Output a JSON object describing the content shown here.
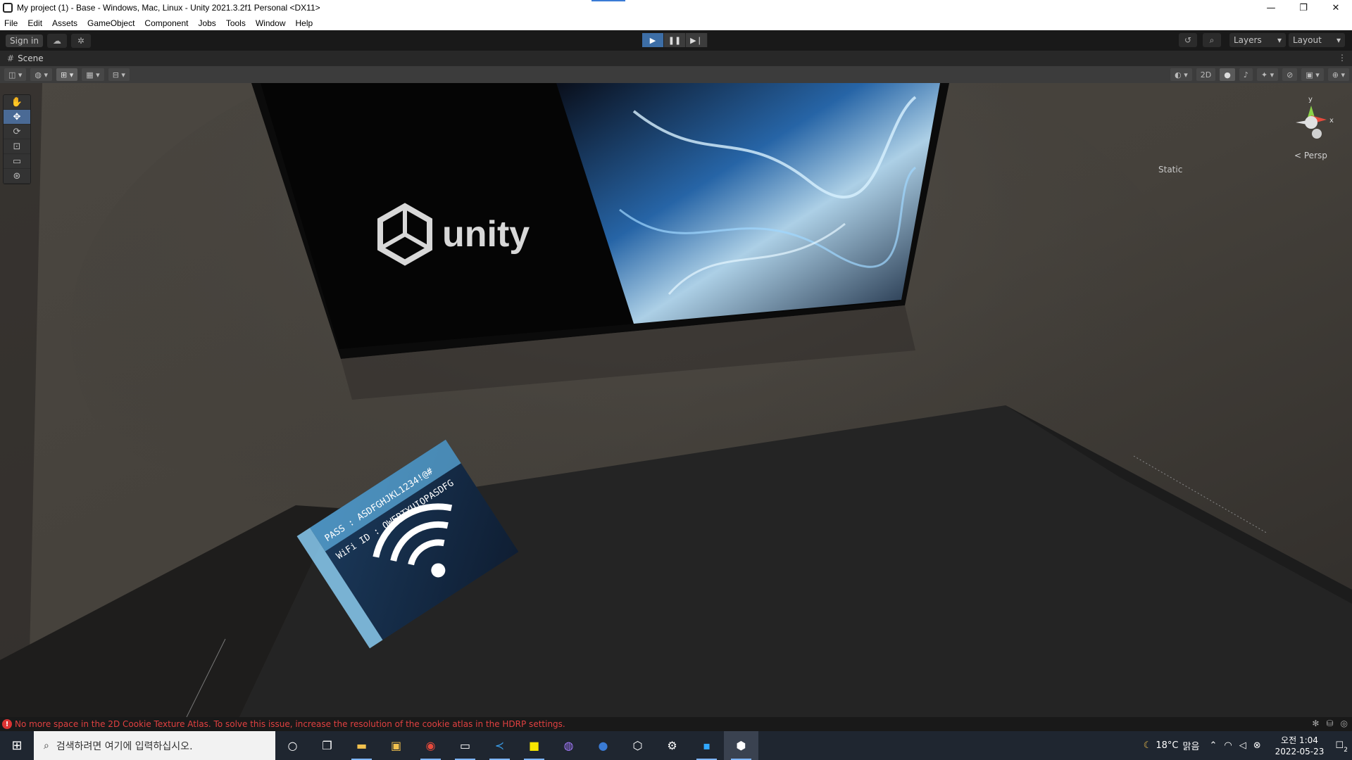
{
  "window": {
    "title": "My project (1) - Base - Windows, Mac, Linux - Unity 2021.3.2f1 Personal <DX11>",
    "minimize": "—",
    "maximize": "❐",
    "close": "✕"
  },
  "menu": [
    "File",
    "Edit",
    "Assets",
    "GameObject",
    "Component",
    "Jobs",
    "Tools",
    "Window",
    "Help"
  ],
  "toolbar": {
    "sign_in": "Sign in",
    "layers_label": "Layers",
    "layout_label": "Layout"
  },
  "scene_tab": {
    "label": "Scene"
  },
  "scene_toolbar": {
    "mode_2d": "2D"
  },
  "scene": {
    "static_label": "Static",
    "persp_label": "Persp",
    "gizmo_y": "y",
    "gizmo_x": "x",
    "screen_logo_text": "unity",
    "wifi_card_id": "WiFi ID : QWERTYUIOPASDFG",
    "wifi_card_pass": "PASS : ASDFGHJKL1234!@#"
  },
  "status": {
    "error_text": "No more space in the 2D Cookie Texture Atlas. To solve this issue, increase the resolution of the cookie atlas in the HDRP settings."
  },
  "taskbar": {
    "search_placeholder": "검색하려면 여기에 입력하십시오.",
    "weather_temp": "18°C",
    "weather_desc": "맑음",
    "time": "오전 1:04",
    "date": "2022-05-23",
    "notification_count": "2"
  },
  "colors": {
    "play_active": "#3d6ea6",
    "error_red": "#e04040",
    "taskbar_bg": "#1f2630"
  }
}
